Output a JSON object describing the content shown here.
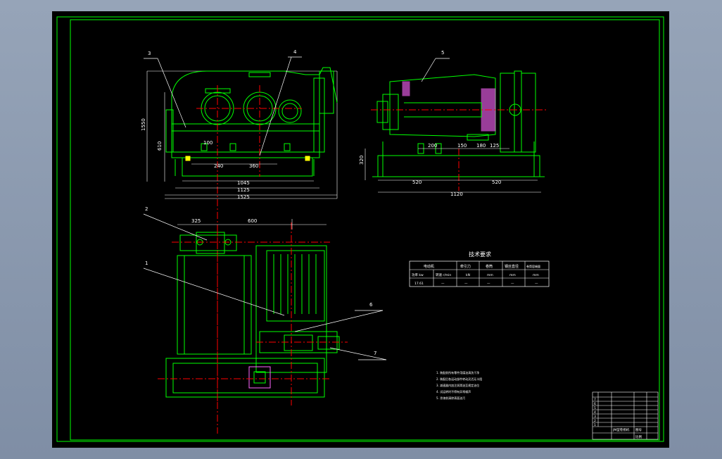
{
  "drawing": {
    "views": {
      "front_view": {
        "balloons": [
          "3",
          "4"
        ],
        "dims": {
          "height_total": "1550",
          "height_base": "610",
          "d100": "100",
          "d240": "240",
          "d360": "360",
          "d1045": "1045",
          "d1125": "1125",
          "d1525": "1525"
        }
      },
      "side_view": {
        "balloons": [
          "5"
        ],
        "dims": {
          "d200": "200",
          "d150": "150",
          "d180": "180",
          "d125": "125",
          "d320": "320",
          "d520a": "520",
          "d520b": "520",
          "d1120": "1120"
        }
      },
      "top_view": {
        "balloons": [
          "2",
          "1",
          "6",
          "7"
        ],
        "dims": {
          "d325": "325",
          "d600": "600"
        }
      }
    },
    "tech_table": {
      "title": "技术要求",
      "headers": [
        "电动机",
        "",
        "牵引力",
        "卷筒",
        "钢丝直径",
        "卷筒容绳量"
      ],
      "row1": [
        "功率 kw",
        "转速 r/min",
        "kN",
        "mm",
        "mm",
        "mm"
      ],
      "row2": [
        "17.61",
        "—",
        "—",
        "—",
        "—",
        "—"
      ]
    },
    "notes": [
      "1. 装配前所有零件用煤油清洗干净",
      "2. 装配后各运动部件转动灵活无卡阻",
      "3. 减速器内加注润滑油至规定油位",
      "4. 试运转时不得有异常噪声",
      "5. 涂漆前清除表面油污"
    ],
    "title_block": {
      "rows": [
        "7",
        "6",
        "5",
        "4",
        "3",
        "2",
        "1"
      ],
      "name": "JM型卷扬机",
      "label_a": "图号",
      "label_b": "比例"
    }
  },
  "colors": {
    "background": "#000000",
    "border": "#00ff00",
    "geometry": "#00ff00",
    "centerline": "#ff0000",
    "dimension": "#ffffff",
    "hatch": "#ff66ff",
    "frame_bg": "#8d9bb0"
  }
}
